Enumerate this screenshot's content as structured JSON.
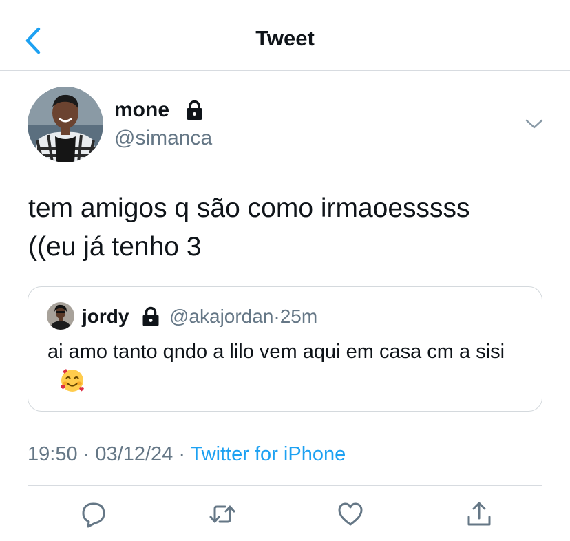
{
  "header": {
    "title": "Tweet",
    "back_icon": "chevron-left-icon"
  },
  "tweet": {
    "author_name": "mone",
    "handle": "@simanca",
    "protected_icon": "lock-icon",
    "menu_icon": "chevron-down-icon",
    "text_line1": "tem amigos q são como irmaoesssss",
    "text_line2": "((eu já tenho 3",
    "time": "19:50",
    "date": "03/12/24",
    "separator": "·",
    "source": "Twitter for iPhone"
  },
  "quoted_tweet": {
    "author_name": "jordy",
    "handle": "@akajordan",
    "separator": "·",
    "age": "25m",
    "text": "ai amo tanto qndo a lilo vem aqui em casa cm a sisi",
    "emoji": "🥰"
  },
  "actions": [
    "reply-icon",
    "retweet-icon",
    "like-icon",
    "share-icon"
  ],
  "colors": {
    "accent": "#1da1f2",
    "text": "#0f1419",
    "muted": "#657786",
    "divider": "#d7dbe0"
  }
}
